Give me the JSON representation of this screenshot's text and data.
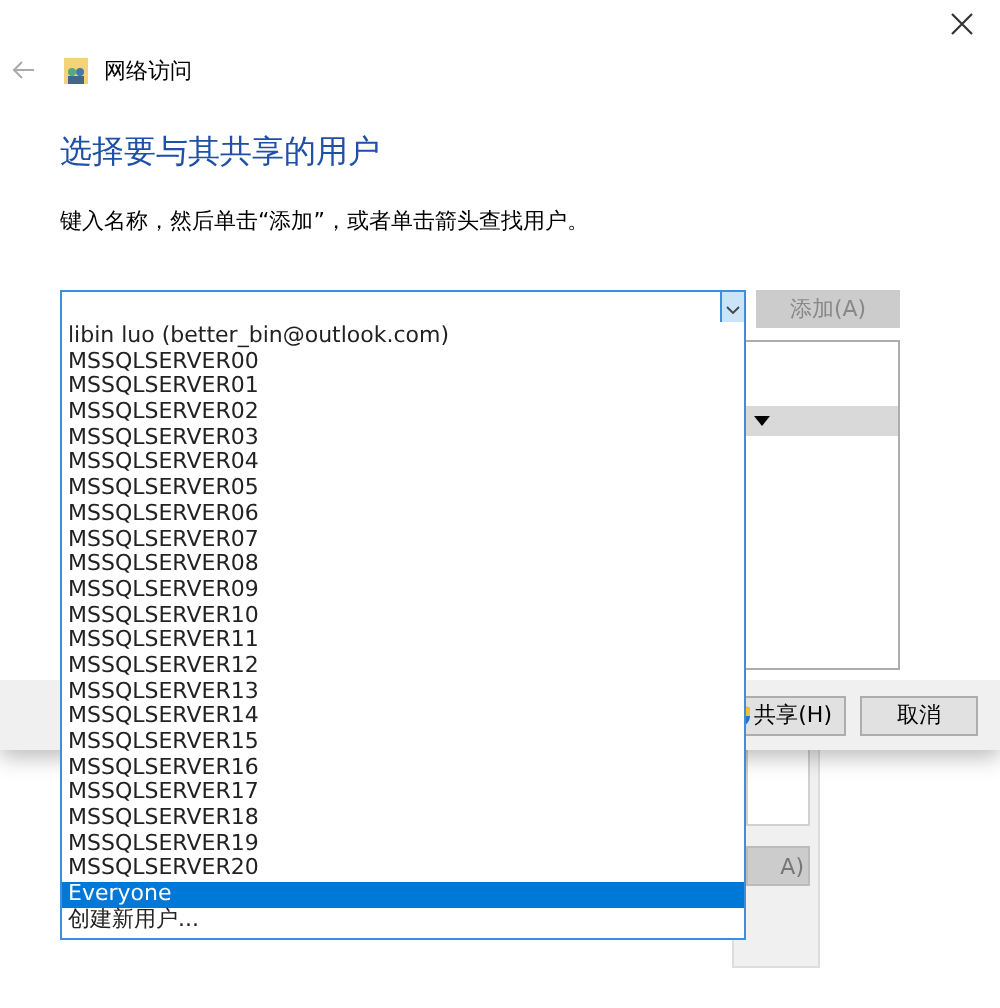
{
  "window": {
    "title": "网络访问"
  },
  "heading": "选择要与其共享的用户",
  "instruction": "键入名称，然后单击“添加”，或者单击箭头查找用户。",
  "add_button": {
    "label": "添加(A)",
    "disabled": true
  },
  "dropdown": {
    "items": [
      {
        "label": "libin luo (better_bin@outlook.com)",
        "selected": false
      },
      {
        "label": "MSSQLSERVER00",
        "selected": false
      },
      {
        "label": "MSSQLSERVER01",
        "selected": false
      },
      {
        "label": "MSSQLSERVER02",
        "selected": false
      },
      {
        "label": "MSSQLSERVER03",
        "selected": false
      },
      {
        "label": "MSSQLSERVER04",
        "selected": false
      },
      {
        "label": "MSSQLSERVER05",
        "selected": false
      },
      {
        "label": "MSSQLSERVER06",
        "selected": false
      },
      {
        "label": "MSSQLSERVER07",
        "selected": false
      },
      {
        "label": "MSSQLSERVER08",
        "selected": false
      },
      {
        "label": "MSSQLSERVER09",
        "selected": false
      },
      {
        "label": "MSSQLSERVER10",
        "selected": false
      },
      {
        "label": "MSSQLSERVER11",
        "selected": false
      },
      {
        "label": "MSSQLSERVER12",
        "selected": false
      },
      {
        "label": "MSSQLSERVER13",
        "selected": false
      },
      {
        "label": "MSSQLSERVER14",
        "selected": false
      },
      {
        "label": "MSSQLSERVER15",
        "selected": false
      },
      {
        "label": "MSSQLSERVER16",
        "selected": false
      },
      {
        "label": "MSSQLSERVER17",
        "selected": false
      },
      {
        "label": "MSSQLSERVER18",
        "selected": false
      },
      {
        "label": "MSSQLSERVER19",
        "selected": false
      },
      {
        "label": "MSSQLSERVER20",
        "selected": false
      },
      {
        "label": "Everyone",
        "selected": true
      },
      {
        "label": "创建新用户...",
        "selected": false
      }
    ]
  },
  "buttons": [
    {
      "label": "共享(H)",
      "kind": "shield"
    },
    {
      "label": "取消",
      "kind": "plain"
    }
  ],
  "background_window": {
    "button_label": "A)"
  }
}
